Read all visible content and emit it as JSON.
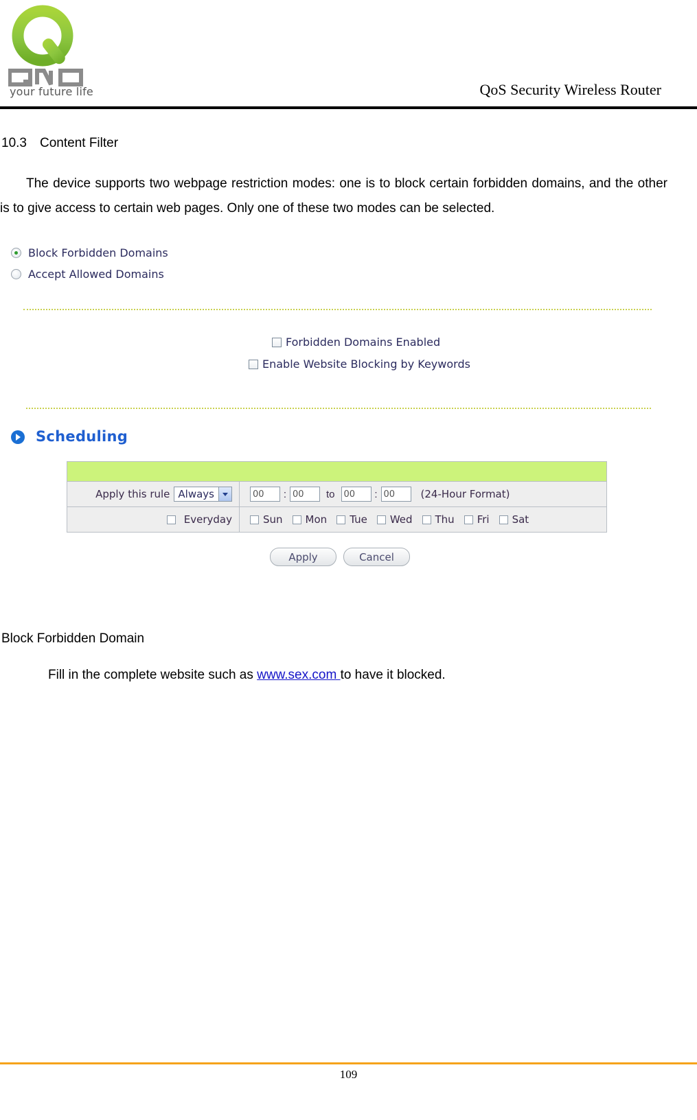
{
  "header": {
    "title": "QoS Security Wireless Router",
    "logo": {
      "brand": "QNO",
      "tagline": "your future life"
    }
  },
  "section": {
    "number": "10.3",
    "title": "Content Filter",
    "paragraph": "The device supports two webpage restriction modes: one is to block certain forbidden domains, and the other is to give access to certain web pages. Only one of these two modes can be selected."
  },
  "screenshot": {
    "radios": [
      {
        "label": "Block Forbidden Domains",
        "selected": true
      },
      {
        "label": "Accept Allowed Domains",
        "selected": false
      }
    ],
    "checkboxes": [
      {
        "label": "Forbidden Domains Enabled",
        "checked": false
      },
      {
        "label": "Enable Website Blocking by Keywords",
        "checked": false
      }
    ],
    "scheduling": {
      "heading": "Scheduling",
      "apply_rule_label": "Apply this rule",
      "rule_value": "Always",
      "time_start_hour": "00",
      "time_start_min": "00",
      "time_end_hour": "00",
      "time_end_min": "00",
      "to_label": "to",
      "colon": ":",
      "format_note": "(24-Hour Format)",
      "everyday_label": "Everyday",
      "days": [
        "Sun",
        "Mon",
        "Tue",
        "Wed",
        "Thu",
        "Fri",
        "Sat"
      ]
    },
    "buttons": {
      "apply": "Apply",
      "cancel": "Cancel"
    }
  },
  "lower": {
    "subheading": "Block Forbidden Domain",
    "fill_prefix": "Fill in the complete website such as ",
    "fill_link": "www.sex.com ",
    "fill_suffix": "to have it blocked."
  },
  "footer": {
    "page_number": "109"
  },
  "colors": {
    "accent_orange": "#f6a31a",
    "scheduling_blue": "#1f5fd0",
    "table_green": "#ccf37b",
    "link_blue": "#1414c8",
    "radio_green": "#2f9c2f"
  }
}
